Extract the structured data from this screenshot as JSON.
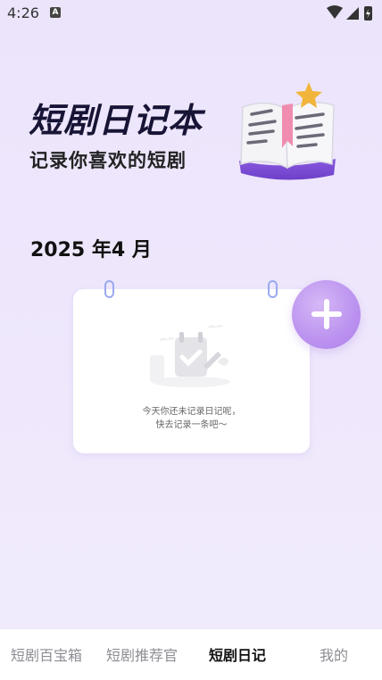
{
  "status_bar": {
    "time": "4:26",
    "notification_letter": "A"
  },
  "hero": {
    "title": "短剧日记本",
    "subtitle": "记录你喜欢的短剧"
  },
  "calendar": {
    "month_label": "2025 年4 月"
  },
  "empty_state": {
    "line1": "今天你还未记录日记呢，",
    "line2": "快去记录一条吧～"
  },
  "bottom_nav": {
    "items": [
      {
        "label": "短剧百宝箱",
        "active": false
      },
      {
        "label": "短剧推荐官",
        "active": false
      },
      {
        "label": "短剧日记",
        "active": true
      },
      {
        "label": "我的",
        "active": false
      }
    ]
  },
  "colors": {
    "accent": "#b98df0",
    "title": "#171435",
    "background": "#ece4fb"
  }
}
